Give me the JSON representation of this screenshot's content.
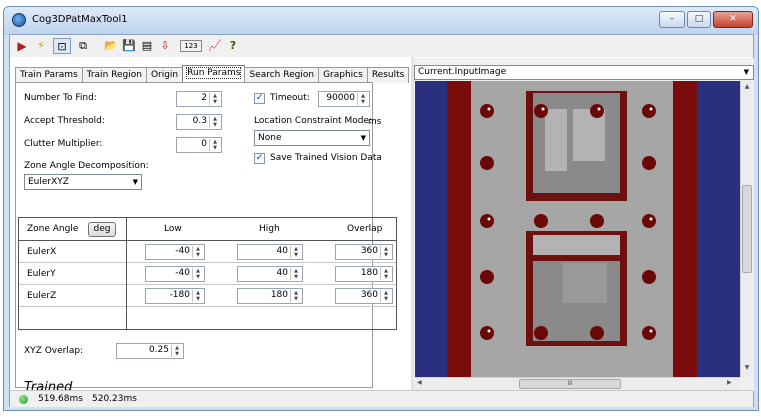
{
  "window": {
    "title": "Cog3DPatMaxTool1",
    "controls": [
      "–",
      "□",
      "✕"
    ]
  },
  "toolbar": {
    "buttons": [
      {
        "name": "run-tool-button",
        "glyph": "▶"
      },
      {
        "name": "electric-run-button",
        "glyph": "⚡"
      },
      {
        "name": "toggle-display-button",
        "glyph": "⊡"
      },
      {
        "name": "copy-button",
        "glyph": "⧉"
      },
      {
        "name": "open-file-button",
        "glyph": "📂"
      },
      {
        "name": "save-button",
        "glyph": "💾"
      },
      {
        "name": "save-as-button",
        "glyph": "▤"
      },
      {
        "name": "import-button",
        "glyph": "⇩"
      },
      {
        "name": "numeric-display-button",
        "glyph": "123"
      },
      {
        "name": "graph-button",
        "glyph": "📈"
      },
      {
        "name": "help-button",
        "glyph": "?"
      }
    ]
  },
  "tabs": [
    "Train Params",
    "Train Region",
    "Origin",
    "Run Params",
    "Search Region",
    "Graphics",
    "Results"
  ],
  "active_tab": "Run Params",
  "run_params": {
    "number_to_find": {
      "label": "Number To Find:",
      "value": "2"
    },
    "accept_threshold": {
      "label": "Accept Threshold:",
      "value": "0.3"
    },
    "clutter_multiplier": {
      "label": "Clutter Multiplier:",
      "value": "0"
    },
    "timeout": {
      "label": "Timeout:",
      "value": "90000",
      "unit": "ms",
      "checked": true
    },
    "location_constraint": {
      "label": "Location Constraint Mode:",
      "value": "None"
    },
    "save_trained": {
      "label": "Save Trained Vision Data",
      "checked": true
    },
    "zone_decomp": {
      "label": "Zone Angle Decomposition:",
      "value": "EulerXYZ"
    },
    "xyz_overlap": {
      "label": "XYZ Overlap:",
      "value": "0.25"
    }
  },
  "zone_table": {
    "header_label": "Zone Angle",
    "unit_button": "deg",
    "columns": [
      "Low",
      "High",
      "Overlap"
    ],
    "rows": [
      {
        "label": "EulerX",
        "low": "-40",
        "high": "40",
        "overlap": "360"
      },
      {
        "label": "EulerY",
        "low": "-40",
        "high": "40",
        "overlap": "180"
      },
      {
        "label": "EulerZ",
        "low": "-180",
        "high": "180",
        "overlap": "360"
      }
    ]
  },
  "train_state": "Trained",
  "image_panel": {
    "selected": "Current.InputImage",
    "hscroll_label": "III"
  },
  "status": {
    "time1": "519.68ms",
    "time2": "520.23ms",
    "indicator_color": "#1d9a1d"
  },
  "colors": {
    "image_bg": "#a6a6a6",
    "navy": "#2a2f7e",
    "dark_red": "#7a0c0c"
  }
}
